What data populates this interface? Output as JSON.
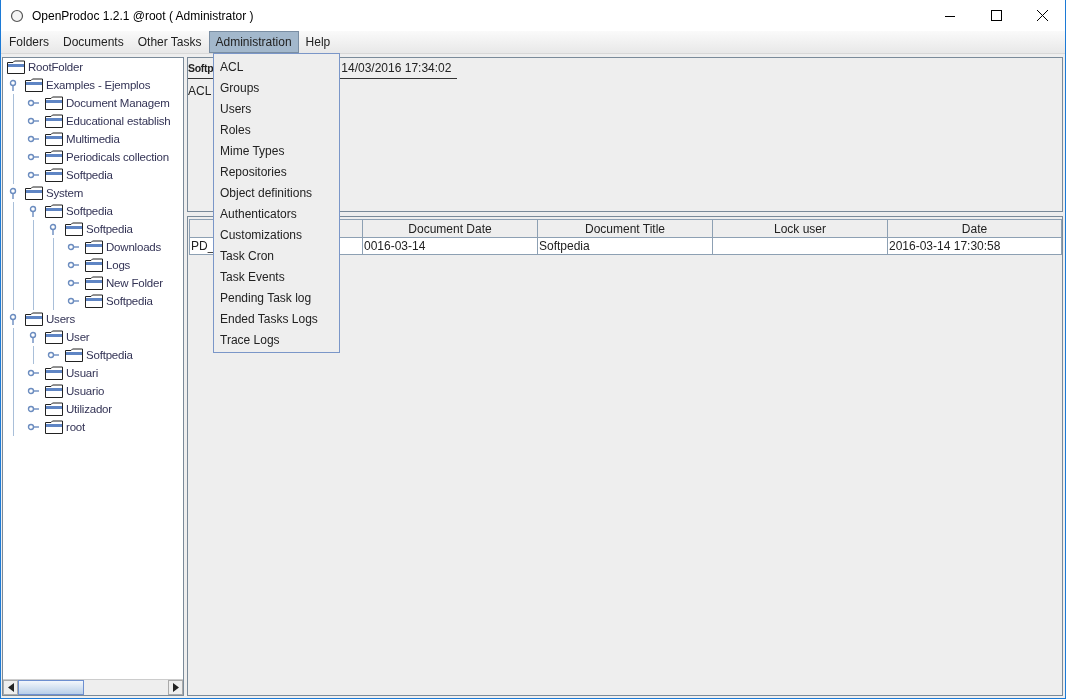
{
  "window": {
    "title": "OpenProdoc 1.2.1 @root ( Administrator )"
  },
  "menu_bar": [
    {
      "label": "Folders",
      "selected": false
    },
    {
      "label": "Documents",
      "selected": false
    },
    {
      "label": "Other Tasks",
      "selected": false
    },
    {
      "label": "Administration",
      "selected": true
    },
    {
      "label": "Help",
      "selected": false
    }
  ],
  "dropdown_menu": [
    "ACL",
    "Groups",
    "Users",
    "Roles",
    "Mime Types",
    "Repositories",
    "Object definitions",
    "Authenticators",
    "Customizations",
    "Task Cron",
    "Task Events",
    "Pending Task log",
    "Ended Tasks Logs",
    "Trace Logs"
  ],
  "folder_tree": {
    "label": "RootFolder",
    "children": [
      {
        "label": "Examples - Ejemplos",
        "expanded": true,
        "children": [
          {
            "label": "Document Managem",
            "expanded": false
          },
          {
            "label": "Educational establish",
            "expanded": false
          },
          {
            "label": "Multimedia",
            "expanded": false
          },
          {
            "label": "Periodicals collection",
            "expanded": false
          },
          {
            "label": "Softpedia",
            "expanded": false
          }
        ]
      },
      {
        "label": "System",
        "expanded": true,
        "children": [
          {
            "label": "Softpedia",
            "expanded": true,
            "children": [
              {
                "label": "Softpedia",
                "expanded": true,
                "children": [
                  {
                    "label": "Downloads",
                    "expanded": false
                  },
                  {
                    "label": "Logs",
                    "expanded": false
                  },
                  {
                    "label": "New Folder",
                    "expanded": false
                  },
                  {
                    "label": "Softpedia",
                    "expanded": false
                  }
                ]
              }
            ]
          }
        ]
      },
      {
        "label": "Users",
        "expanded": true,
        "children": [
          {
            "label": "User",
            "expanded": true,
            "children": [
              {
                "label": "Softpedia",
                "expanded": false
              }
            ]
          },
          {
            "label": "Usuari",
            "expanded": false
          },
          {
            "label": "Usuario",
            "expanded": false
          },
          {
            "label": "Utilizador",
            "expanded": false
          },
          {
            "label": "root",
            "expanded": false
          }
        ]
      }
    ]
  },
  "info_panel": {
    "name": "Softp",
    "timestamp": "14/03/2016 17:34:02",
    "acl": "ACL"
  },
  "table": {
    "columns": [
      null,
      null,
      "Document Date",
      "Document Title",
      "Lock user",
      "Date"
    ],
    "rows": [
      [
        "PD_",
        null,
        "0016-03-14",
        "Softpedia",
        null,
        "2016-03-14 17:30:58"
      ]
    ]
  }
}
